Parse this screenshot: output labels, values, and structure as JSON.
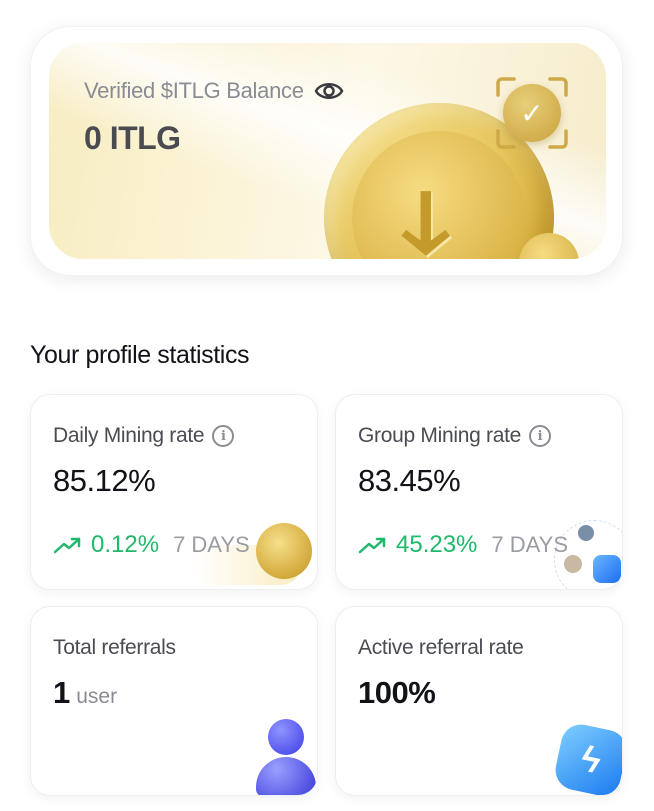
{
  "balance": {
    "label": "Verified $ITLG Balance",
    "value": "0 ITLG"
  },
  "section_title": "Your profile statistics",
  "stats": {
    "daily": {
      "label": "Daily Mining rate",
      "value": "85.12%",
      "change": "0.12%",
      "period": "7 DAYS"
    },
    "group": {
      "label": "Group Mining rate",
      "value": "83.45%",
      "change": "45.23%",
      "period": "7 DAYS"
    },
    "referrals": {
      "label": "Total referrals",
      "value": "1",
      "unit": "user"
    },
    "active_rate": {
      "label": "Active referral rate",
      "value": "100%"
    }
  },
  "icons": {
    "eye": "eye-icon",
    "info": "info-icon",
    "trend": "trend-up-icon",
    "verify": "verified-check-icon"
  },
  "colors": {
    "positive": "#20b86a",
    "accent_gold": "#d3aa3c"
  }
}
